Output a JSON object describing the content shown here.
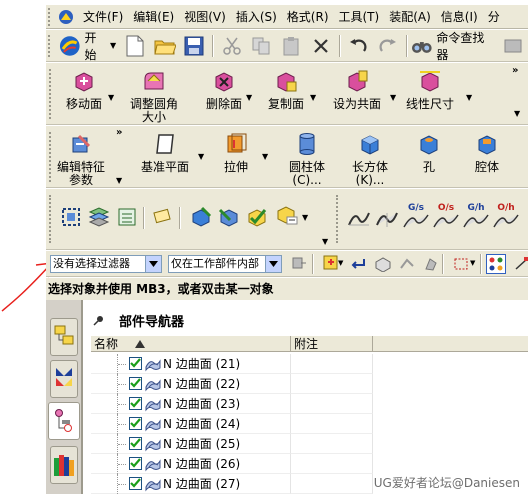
{
  "menu": [
    "文件(F)",
    "编辑(E)",
    "视图(V)",
    "插入(S)",
    "格式(R)",
    "工具(T)",
    "装配(A)",
    "信息(I)",
    "分"
  ],
  "standard": {
    "start_label": "开始",
    "command_finder": "命令查找器"
  },
  "edit_toolbar": [
    "移动面",
    "调整圆角大小",
    "删除面",
    "复制面",
    "设为共面",
    "线性尺寸"
  ],
  "feature_toolbar": {
    "edit_feature_params": "编辑特征参数",
    "datum_plane": "基准平面",
    "extrude": "拉伸",
    "cylinder": "圆柱体(C)...",
    "block": "长方体(K)...",
    "hole": "孔",
    "pocket": "腔体"
  },
  "analysis_labels": [
    "G/s",
    "O/s",
    "G/h",
    "O/h"
  ],
  "filters": {
    "type_filter": "没有选择过滤器",
    "scope_filter": "仅在工作部件内部"
  },
  "status_text": "选择对象并使用 MB3，或者双击某一对象",
  "navigator": {
    "title": "部件导航器",
    "columns": [
      "名称",
      "附注"
    ],
    "items": [
      "N 边曲面 (21)",
      "N 边曲面 (22)",
      "N 边曲面 (23)",
      "N 边曲面 (24)",
      "N 边曲面 (25)",
      "N 边曲面 (26)",
      "N 边曲面 (27)"
    ]
  },
  "watermark": "UG爱好者论坛@Daniesen",
  "colors": {
    "toolbar_bg": "#ece9d8",
    "annotation_red": "#e8201c",
    "check_green": "#1a9e1a"
  }
}
